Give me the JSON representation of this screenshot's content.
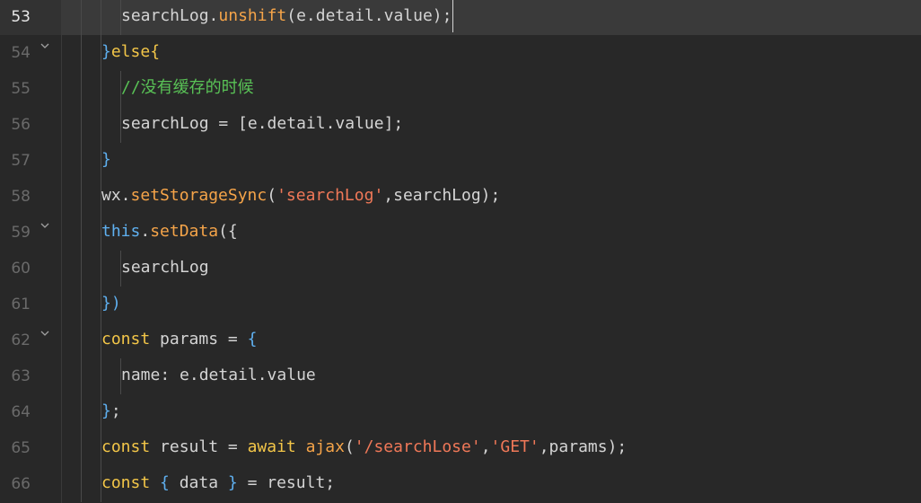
{
  "editor": {
    "current_line": "53",
    "lines": [
      {
        "num": "53",
        "fold": false,
        "indent": 2,
        "tokens": [
          {
            "t": "searchLog",
            "c": "p"
          },
          {
            "t": ".",
            "c": "p"
          },
          {
            "t": "unshift",
            "c": "fn"
          },
          {
            "t": "(e.detail.value);",
            "c": "p"
          }
        ]
      },
      {
        "num": "54",
        "fold": true,
        "indent": 1,
        "tokens": [
          {
            "t": "}",
            "c": "br"
          },
          {
            "t": "else",
            "c": "kw"
          },
          {
            "t": "{",
            "c": "kw"
          }
        ]
      },
      {
        "num": "55",
        "fold": false,
        "indent": 2,
        "tokens": [
          {
            "t": "//没有缓存的时候",
            "c": "cm"
          }
        ]
      },
      {
        "num": "56",
        "fold": false,
        "indent": 2,
        "tokens": [
          {
            "t": "searchLog = [e.detail.value];",
            "c": "p"
          }
        ]
      },
      {
        "num": "57",
        "fold": false,
        "indent": 1,
        "tokens": [
          {
            "t": "}",
            "c": "br"
          }
        ]
      },
      {
        "num": "58",
        "fold": false,
        "indent": 1,
        "tokens": [
          {
            "t": "wx.",
            "c": "p"
          },
          {
            "t": "setStorageSync",
            "c": "fn"
          },
          {
            "t": "(",
            "c": "p"
          },
          {
            "t": "'searchLog'",
            "c": "str"
          },
          {
            "t": ",searchLog);",
            "c": "p"
          }
        ]
      },
      {
        "num": "59",
        "fold": true,
        "indent": 1,
        "tokens": [
          {
            "t": "this",
            "c": "kwb"
          },
          {
            "t": ".",
            "c": "p"
          },
          {
            "t": "setData",
            "c": "fn"
          },
          {
            "t": "({",
            "c": "p"
          }
        ]
      },
      {
        "num": "60",
        "fold": false,
        "indent": 2,
        "tokens": [
          {
            "t": "searchLog",
            "c": "p"
          }
        ]
      },
      {
        "num": "61",
        "fold": false,
        "indent": 1,
        "tokens": [
          {
            "t": "})",
            "c": "br"
          }
        ]
      },
      {
        "num": "62",
        "fold": true,
        "indent": 1,
        "tokens": [
          {
            "t": "const",
            "c": "kw"
          },
          {
            "t": " params = ",
            "c": "p"
          },
          {
            "t": "{",
            "c": "br"
          }
        ]
      },
      {
        "num": "63",
        "fold": false,
        "indent": 2,
        "tokens": [
          {
            "t": "name: e.detail.value",
            "c": "p"
          }
        ]
      },
      {
        "num": "64",
        "fold": false,
        "indent": 1,
        "tokens": [
          {
            "t": "}",
            "c": "br"
          },
          {
            "t": ";",
            "c": "p"
          }
        ]
      },
      {
        "num": "65",
        "fold": false,
        "indent": 1,
        "tokens": [
          {
            "t": "const",
            "c": "kw"
          },
          {
            "t": " result = ",
            "c": "p"
          },
          {
            "t": "await",
            "c": "kw"
          },
          {
            "t": " ",
            "c": "p"
          },
          {
            "t": "ajax",
            "c": "fn"
          },
          {
            "t": "(",
            "c": "p"
          },
          {
            "t": "'/searchLose'",
            "c": "str"
          },
          {
            "t": ",",
            "c": "p"
          },
          {
            "t": "'GET'",
            "c": "str"
          },
          {
            "t": ",params);",
            "c": "p"
          }
        ]
      },
      {
        "num": "66",
        "fold": false,
        "indent": 1,
        "tokens": [
          {
            "t": "const",
            "c": "kw"
          },
          {
            "t": " ",
            "c": "p"
          },
          {
            "t": "{",
            "c": "br"
          },
          {
            "t": " data ",
            "c": "p"
          },
          {
            "t": "}",
            "c": "br"
          },
          {
            "t": " = result;",
            "c": "p"
          }
        ]
      }
    ]
  }
}
